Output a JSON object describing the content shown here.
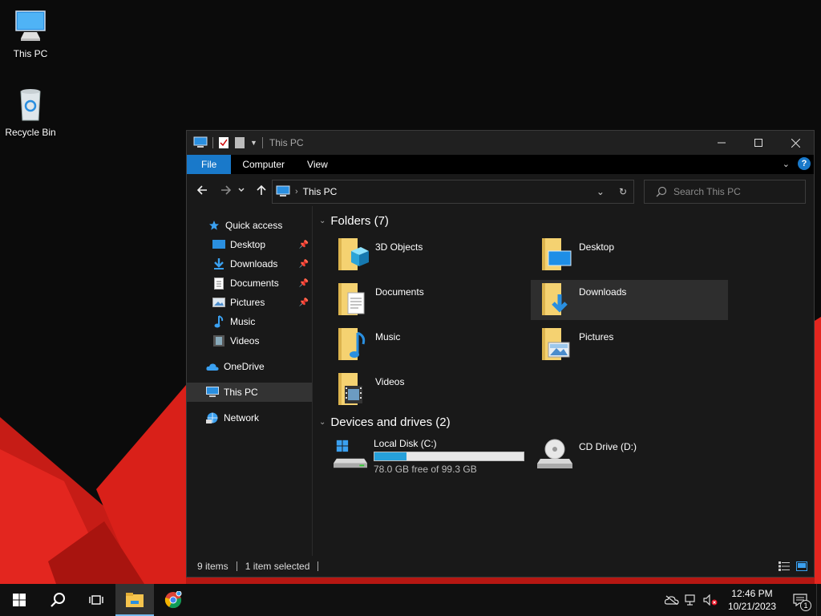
{
  "desktop": {
    "icons": [
      {
        "label": "This PC"
      },
      {
        "label": "Recycle Bin"
      }
    ]
  },
  "window": {
    "title": "This PC",
    "ribbon_tabs": [
      "File",
      "Computer",
      "View"
    ],
    "help_label": "?"
  },
  "navbar": {
    "address_crumb": "This PC",
    "search_placeholder": "Search This PC"
  },
  "navpane": {
    "quick_access": "Quick access",
    "items": [
      {
        "label": "Desktop",
        "pinned": true
      },
      {
        "label": "Downloads",
        "pinned": true
      },
      {
        "label": "Documents",
        "pinned": true
      },
      {
        "label": "Pictures",
        "pinned": true
      },
      {
        "label": "Music",
        "pinned": false
      },
      {
        "label": "Videos",
        "pinned": false
      }
    ],
    "onedrive": "OneDrive",
    "this_pc": "This PC",
    "network": "Network"
  },
  "content": {
    "folders_header": "Folders (7)",
    "folders": [
      {
        "label": "3D Objects"
      },
      {
        "label": "Desktop"
      },
      {
        "label": "Documents"
      },
      {
        "label": "Downloads"
      },
      {
        "label": "Music"
      },
      {
        "label": "Pictures"
      },
      {
        "label": "Videos"
      }
    ],
    "drives_header": "Devices and drives (2)",
    "drives": [
      {
        "label": "Local Disk (C:)",
        "free_text": "78.0 GB free of 99.3 GB",
        "used_fraction": 0.2145
      },
      {
        "label": "CD Drive (D:)"
      }
    ]
  },
  "statusbar": {
    "items_count": "9 items",
    "selection": "1 item selected"
  },
  "taskbar": {
    "time": "12:46 PM",
    "date": "10/21/2023",
    "notification_count": "1"
  },
  "colors": {
    "accent": "#1979ca",
    "drive_fill": "#26a0da",
    "wallpaper_red": "#e3261f"
  }
}
